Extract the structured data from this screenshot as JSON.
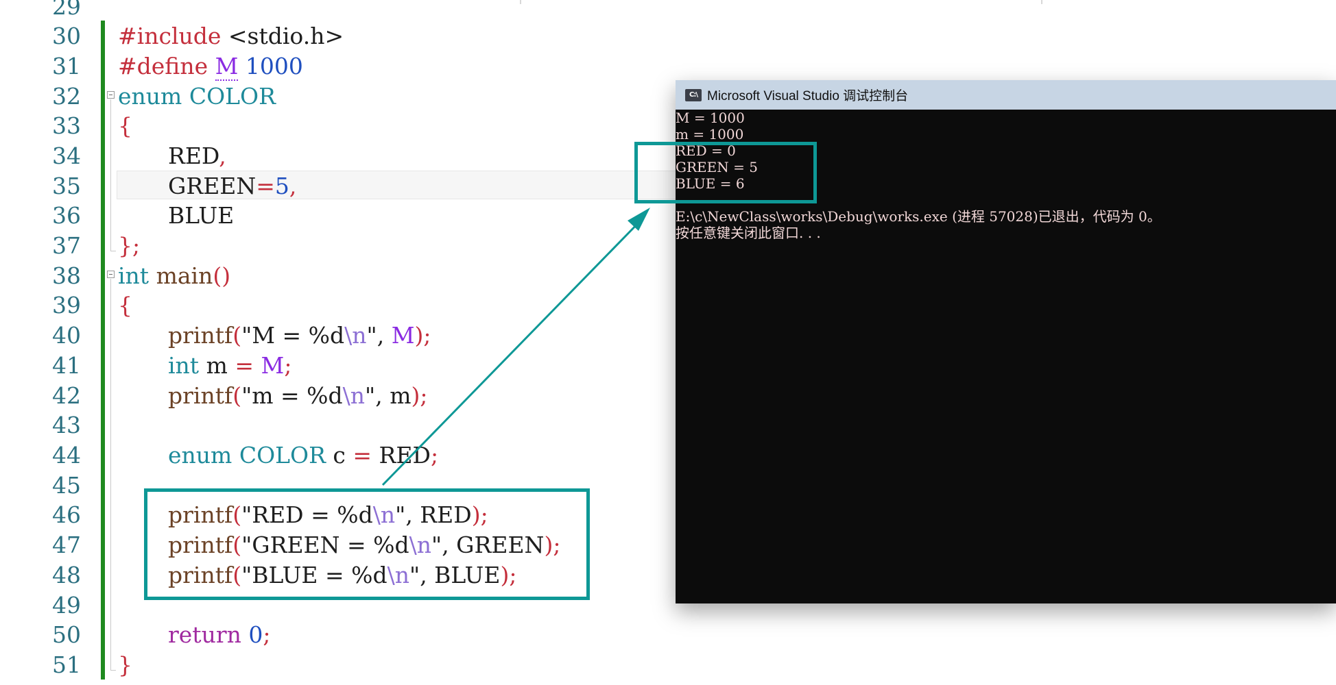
{
  "editor": {
    "lines": [
      {
        "n": "29"
      },
      {
        "n": "30"
      },
      {
        "n": "31"
      },
      {
        "n": "32"
      },
      {
        "n": "33"
      },
      {
        "n": "34"
      },
      {
        "n": "35"
      },
      {
        "n": "36"
      },
      {
        "n": "37"
      },
      {
        "n": "38"
      },
      {
        "n": "39"
      },
      {
        "n": "40"
      },
      {
        "n": "41"
      },
      {
        "n": "42"
      },
      {
        "n": "43"
      },
      {
        "n": "44"
      },
      {
        "n": "45"
      },
      {
        "n": "46"
      },
      {
        "n": "47"
      },
      {
        "n": "48"
      },
      {
        "n": "49"
      },
      {
        "n": "50"
      },
      {
        "n": "51"
      }
    ],
    "code": {
      "l30": [
        "#include",
        " <stdio.h>"
      ],
      "l31": [
        "#define",
        " ",
        "M",
        " ",
        "1000"
      ],
      "l32": [
        "enum",
        " COLOR"
      ],
      "l33": [
        "{"
      ],
      "l34": [
        "RED",
        ","
      ],
      "l35": [
        "GREEN",
        "=",
        "5",
        ","
      ],
      "l36": [
        "BLUE"
      ],
      "l37": [
        "}",
        ";"
      ],
      "l38": [
        "int",
        " main",
        "()"
      ],
      "l39": [
        "{"
      ],
      "l40": [
        "printf",
        "(",
        "\"M = %d",
        "\\n",
        "\"",
        ", ",
        "M",
        ")",
        ";"
      ],
      "l41": [
        "int",
        " m ",
        "=",
        " ",
        "M",
        ";"
      ],
      "l42": [
        "printf",
        "(",
        "\"m = %d",
        "\\n",
        "\"",
        ", m",
        ")",
        ";"
      ],
      "l44": [
        "enum",
        " COLOR",
        " c ",
        "=",
        " RED",
        ";"
      ],
      "l46": [
        "printf",
        "(",
        "\"RED = %d",
        "\\n",
        "\"",
        ", RED",
        ")",
        ";"
      ],
      "l47": [
        "printf",
        "(",
        "\"GREEN = %d",
        "\\n",
        "\"",
        ", GREEN",
        ")",
        ";"
      ],
      "l48": [
        "printf",
        "(",
        "\"BLUE = %d",
        "\\n",
        "\"",
        ", BLUE",
        ")",
        ";"
      ],
      "l50": [
        "return",
        " ",
        "0",
        ";"
      ],
      "l51": [
        "}"
      ]
    }
  },
  "console": {
    "title": "Microsoft Visual Studio 调试控制台",
    "icon_name": "visual-studio-console-icon",
    "icon_label": "C:\\",
    "output": [
      "M = 1000",
      "m = 1000",
      "RED = 0",
      "GREEN = 5",
      "BLUE = 6",
      "",
      "E:\\c\\NewClass\\works\\Debug\\works.exe (进程 57028)已退出，代码为 0。",
      "按任意键关闭此窗口. . ."
    ]
  },
  "colors": {
    "annotation": "#0e9896",
    "gutter_change_bar": "#1f8a1f",
    "console_bg": "#0c0c0c",
    "console_text": "#f1d7d7",
    "titlebar": "#c7d5e4"
  }
}
